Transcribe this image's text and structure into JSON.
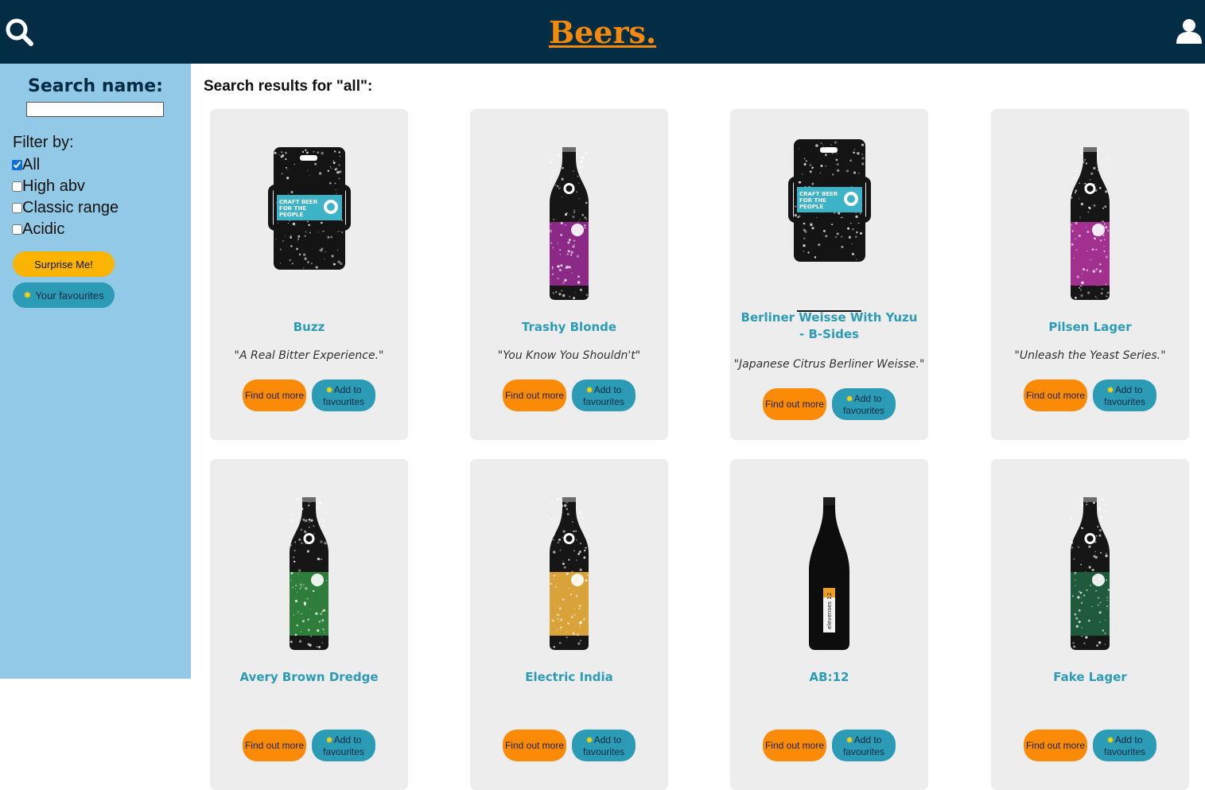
{
  "header": {
    "logo": "Beers.",
    "search_icon": "search-icon",
    "user_icon": "user-icon"
  },
  "sidebar": {
    "title": "Search name:",
    "search_value": "",
    "filter_label": "Filter by:",
    "filters": [
      {
        "label": "All",
        "checked": true
      },
      {
        "label": "High abv",
        "checked": false
      },
      {
        "label": "Classic range",
        "checked": false
      },
      {
        "label": "Acidic",
        "checked": false
      }
    ],
    "surprise_label": "Surprise Me!",
    "favourites_label": "Your favourites",
    "star_icon": "sun-star-icon"
  },
  "main": {
    "results_title": "Search results for \"all\":",
    "cards": [
      {
        "name": "Buzz",
        "tagline": "\"A Real Bitter Experience.\"",
        "image": "keg",
        "label_color": "#3db3c8",
        "more_label": "Find out more",
        "fav_label": "Add to favourites"
      },
      {
        "name": "Trashy Blonde",
        "tagline": "\"You Know You Shouldn't\"",
        "image": "bottle",
        "label_color": "#8b2a86",
        "more_label": "Find out more",
        "fav_label": "Add to favourites"
      },
      {
        "name": "Berliner Weisse With Yuzu - B-Sides",
        "tagline": "\"Japanese Citrus Berliner Weisse.\"",
        "image": "keg",
        "label_color": "#3db3c8",
        "more_label": "Find out more",
        "fav_label": "Add to favourites"
      },
      {
        "name": "Pilsen Lager",
        "tagline": "\"Unleash the Yeast Series.\"",
        "image": "bottle",
        "label_color": "#a1308f",
        "more_label": "Find out more",
        "fav_label": "Add to favourites"
      },
      {
        "name": "Avery Brown Dredge",
        "tagline": "",
        "image": "bottle",
        "label_color": "#2e7d3a",
        "more_label": "Find out more",
        "fav_label": "Add to favourites"
      },
      {
        "name": "Electric India",
        "tagline": "",
        "image": "bottle",
        "label_color": "#d9a33a",
        "more_label": "Find out more",
        "fav_label": "Add to favourites"
      },
      {
        "name": "AB:12",
        "tagline": "",
        "image": "tall_bottle",
        "label_color": "#f0a020",
        "more_label": "Find out more",
        "fav_label": "Add to favourites"
      },
      {
        "name": "Fake Lager",
        "tagline": "",
        "image": "bottle",
        "label_color": "#1f5a3c",
        "more_label": "Find out more",
        "fav_label": "Add to favourites"
      }
    ]
  },
  "colors": {
    "header_bg": "#032c45",
    "sidebar_bg": "#91c9e6",
    "accent_orange": "#fb8b07",
    "accent_teal": "#2c9bb6",
    "accent_yellow": "#fbb500"
  }
}
